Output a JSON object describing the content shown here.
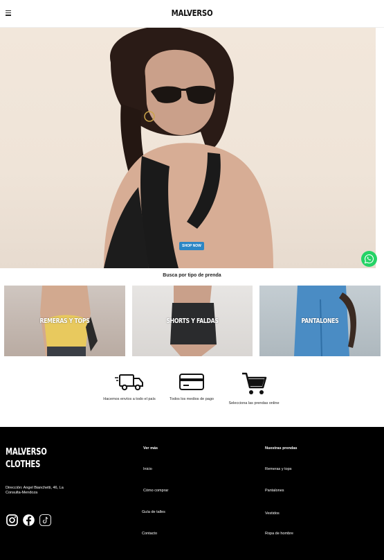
{
  "header": {
    "brand": "MALVERSO",
    "menu_icon": "hamburger-icon"
  },
  "hero": {
    "cta": "SHOP NOW",
    "slides": 3,
    "active_slide": 2
  },
  "whatsapp": {
    "icon": "whatsapp-icon",
    "color": "#25d366"
  },
  "categories": {
    "title": "Busca por tipo de prenda",
    "items": [
      {
        "label": "REMERAS Y TOPS"
      },
      {
        "label": "SHORTS Y FALDAS"
      },
      {
        "label": "PANTALONES"
      }
    ]
  },
  "benefits": [
    {
      "icon": "truck-icon",
      "text": "Hacemos envíos a todo el país"
    },
    {
      "icon": "credit-card-icon",
      "text": "Todos los medios de pago"
    },
    {
      "icon": "cart-icon",
      "text": "Selecciona las prendas online"
    }
  ],
  "footer": {
    "logo_line1": "MALVERSO",
    "logo_line2": "CLOTHES",
    "address": "Dirección: Angel Bianchetti, 46, La Consulta-Mendoza",
    "socials": [
      "instagram-icon",
      "facebook-icon",
      "tiktok-icon"
    ],
    "col1": {
      "title": "Ver más",
      "links": [
        "Inicio",
        "Cómo comprar",
        "Guía de talles",
        "Contacto"
      ]
    },
    "col2": {
      "title": "Nuestras prendas",
      "links": [
        "Remeras y tops",
        "Pantalones",
        "Vestidos",
        "Ropa de hombre"
      ]
    }
  },
  "colors": {
    "accent": "#2b86c5",
    "footer_bg": "#000000"
  }
}
